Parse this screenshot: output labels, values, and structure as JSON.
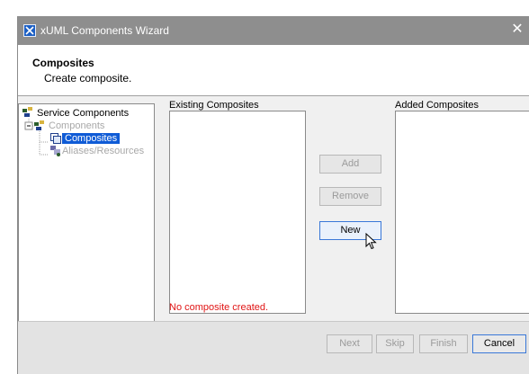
{
  "window": {
    "title": "xUML Components Wizard",
    "close_glyph": "✕"
  },
  "banner": {
    "heading": "Composites",
    "subtitle": "Create composite."
  },
  "tree": {
    "items": [
      {
        "label": "Service Components",
        "icon": "service-components-icon",
        "state": "normal"
      },
      {
        "label": "Components",
        "icon": "components-icon",
        "state": "dimmed"
      },
      {
        "label": "Composites",
        "icon": "composites-icon",
        "state": "selected"
      },
      {
        "label": "Aliases/Resources",
        "icon": "aliases-resources-icon",
        "state": "dimmed"
      }
    ]
  },
  "existing": {
    "label": "Existing Composites"
  },
  "added": {
    "label": "Added Composites"
  },
  "middle_buttons": {
    "add": "Add",
    "remove": "Remove",
    "new": "New"
  },
  "error_message": "No composite created.",
  "footer_buttons": {
    "next": "Next",
    "skip": "Skip",
    "finish": "Finish",
    "cancel": "Cancel"
  },
  "colors": {
    "titlebar": "#8e8e8e",
    "selection": "#0f5bd6",
    "error": "#e01414",
    "focus_border": "#3a78d8"
  }
}
